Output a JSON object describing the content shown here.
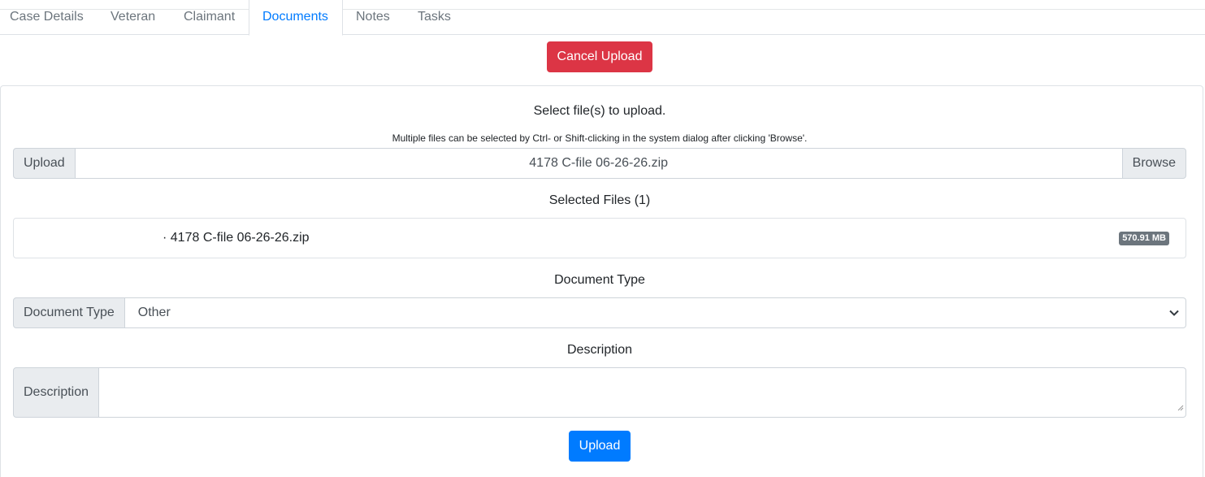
{
  "tabs": [
    {
      "label": "Case Details",
      "active": false
    },
    {
      "label": "Veteran",
      "active": false
    },
    {
      "label": "Claimant",
      "active": false
    },
    {
      "label": "Documents",
      "active": true
    },
    {
      "label": "Notes",
      "active": false
    },
    {
      "label": "Tasks",
      "active": false
    }
  ],
  "cancel_button": "Cancel Upload",
  "upload_section": {
    "title": "Select file(s) to upload.",
    "hint": "Multiple files can be selected by Ctrl- or Shift-clicking in the system dialog after clicking 'Browse'.",
    "upload_label": "Upload",
    "file_value": "4178 C-file 06-26-26.zip",
    "browse_label": "Browse"
  },
  "selected_files": {
    "title": "Selected Files (1)",
    "files": [
      {
        "name": "· 4178 C-file 06-26-26.zip",
        "size": "570.91 MB"
      }
    ]
  },
  "document_type": {
    "title": "Document Type",
    "label": "Document Type",
    "selected": "Other"
  },
  "description": {
    "title": "Description",
    "label": "Description",
    "value": ""
  },
  "upload_button": "Upload",
  "colors": {
    "primary": "#007bff",
    "danger": "#dc3545",
    "badge": "#6c757d"
  }
}
